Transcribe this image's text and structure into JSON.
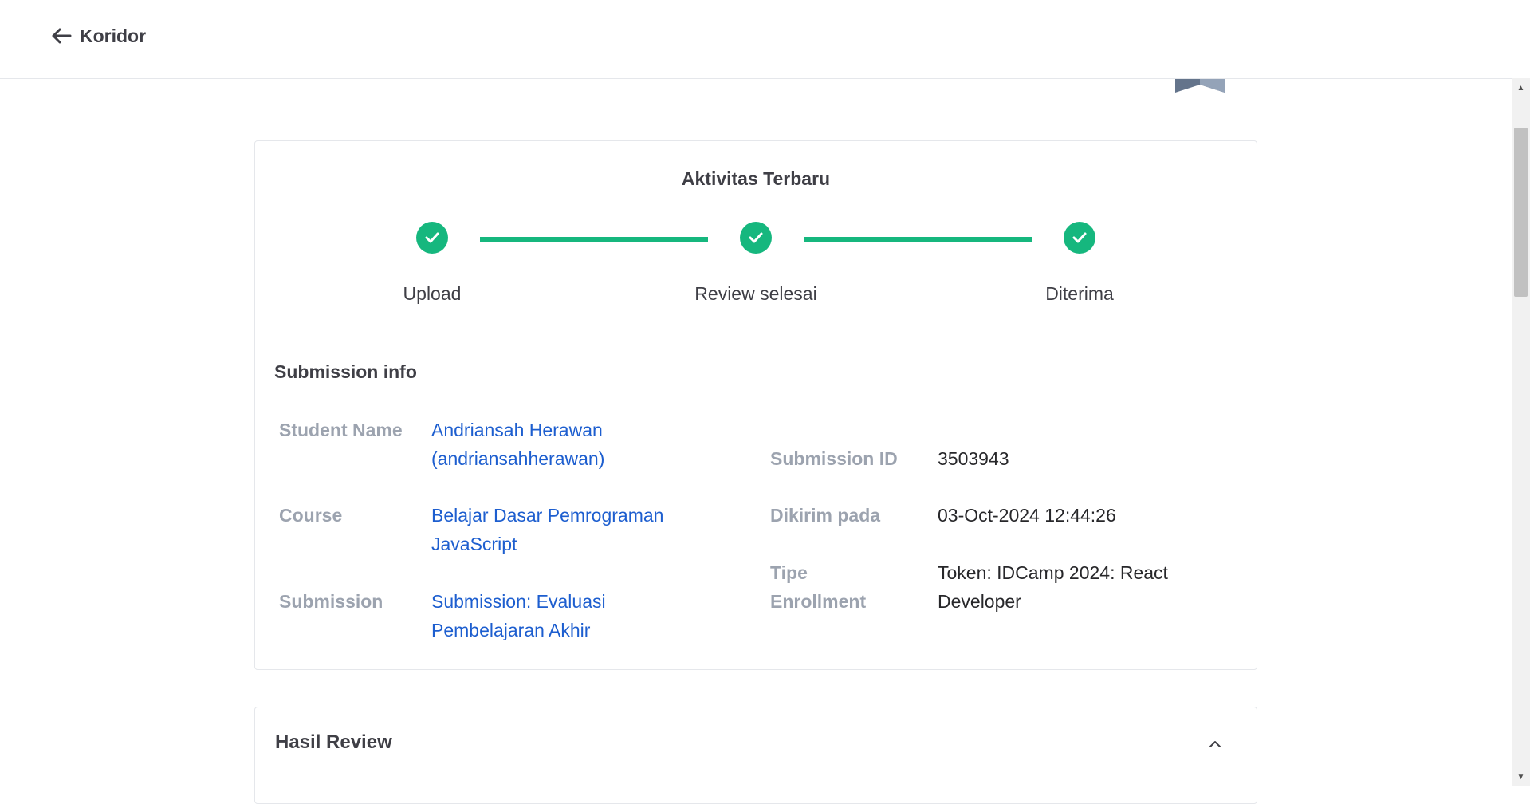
{
  "header": {
    "back_label": "Koridor"
  },
  "activity": {
    "title": "Aktivitas Terbaru",
    "steps": [
      {
        "label": "Upload",
        "done": true
      },
      {
        "label": "Review selesai",
        "done": true
      },
      {
        "label": "Diterima",
        "done": true
      }
    ]
  },
  "submission_info": {
    "title": "Submission info",
    "student_name_label": "Student Name",
    "student_name_line1": "Andriansah Herawan",
    "student_name_line2": "(andriansahherawan)",
    "course_label": "Course",
    "course_line1": "Belajar Dasar Pemrograman",
    "course_line2": "JavaScript",
    "submission_label": "Submission",
    "submission_line1": "Submission: Evaluasi",
    "submission_line2": "Pembelajaran Akhir",
    "submission_id_label": "Submission ID",
    "submission_id_value": "3503943",
    "sent_label": "Dikirim pada",
    "sent_value": "03-Oct-2024 12:44:26",
    "enroll_label_line1": "Tipe",
    "enroll_label_line2": "Enrollment",
    "enroll_value_line1": "Token: IDCamp 2024: React",
    "enroll_value_line2": "Developer"
  },
  "review": {
    "title": "Hasil Review"
  },
  "colors": {
    "accent_green": "#16b77e",
    "link_blue": "#1d5ecf",
    "label_gray": "#9ca3af"
  }
}
